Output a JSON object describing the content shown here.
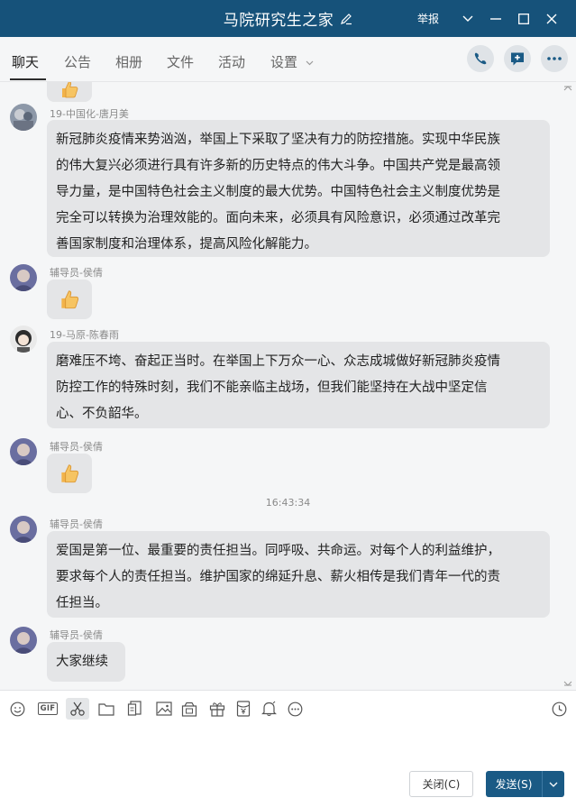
{
  "window": {
    "title": "马院研究生之家",
    "report_label": "举报",
    "title_bar_color": "#16527a"
  },
  "tabs": [
    {
      "label": "聊天",
      "active": true
    },
    {
      "label": "公告"
    },
    {
      "label": "相册"
    },
    {
      "label": "文件"
    },
    {
      "label": "活动"
    },
    {
      "label": "设置"
    }
  ],
  "messages": [
    {
      "sender": "19-中国化-唐月美",
      "lines": [
        "新冠肺炎疫情来势汹汹，举国上下采取了坚决有力的防控措施。实现中华民族",
        "的伟大复兴必须进行具有许多新的历史特点的伟大斗争。中国共产党是最高领",
        "导力量，是中国特色社会主义制度的最大优势。中国特色社会主义制度优势是",
        "完全可以转换为治理效能的。面向未来，必须具有风险意识，必须通过改革完",
        "善国家制度和治理体系，提高风险化解能力。"
      ]
    },
    {
      "sender": "辅导员-侯倩",
      "emoji": "thumbs-up"
    },
    {
      "sender": "19-马原-陈春雨",
      "lines": [
        "磨难压不垮、奋起正当时。在举国上下万众一心、众志成城做好新冠肺炎疫情",
        "防控工作的特殊时刻，我们不能亲临主战场，但我们能坚持在大战中坚定信",
        "心、不负韶华。"
      ]
    },
    {
      "sender": "辅导员-侯倩",
      "emoji": "thumbs-up"
    },
    {
      "timestamp": "16:43:34"
    },
    {
      "sender": "辅导员-侯倩",
      "lines": [
        "爱国是第一位、最重要的责任担当。同呼吸、共命运。对每个人的利益维护，",
        "要求每个人的责任担当。维护国家的绵延升息、薪火相传是我们青年一代的责",
        "任担当。"
      ]
    },
    {
      "sender": "辅导员-侯倩",
      "lines": [
        "大家继续"
      ]
    }
  ],
  "toolbar_icons": [
    "emoji-icon",
    "gif-icon",
    "scissors-icon",
    "folder-icon",
    "screenshot-doc-icon",
    "image-icon",
    "gallery-icon",
    "gift-icon",
    "red-packet-icon",
    "bell-icon",
    "more-icon",
    "history-clock-icon"
  ],
  "gif_label": "GIF",
  "buttons": {
    "close_label": "关闭(C)",
    "send_label": "发送(S)"
  }
}
